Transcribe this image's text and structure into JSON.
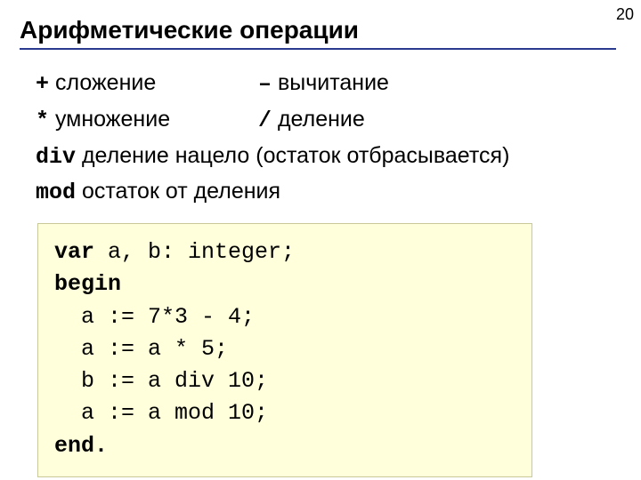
{
  "page_number": "20",
  "heading": "Арифметические операции",
  "ops": {
    "plus_sym": "+",
    "plus_label": " сложение",
    "minus_sym": "–",
    "minus_label": " вычитание",
    "mul_sym": "*",
    "mul_label": " умножение",
    "div_sym": "/",
    "div_label": " деление",
    "idiv_sym": "div",
    "idiv_label": " деление нацело (остаток отбрасывается)",
    "mod_sym": "mod",
    "mod_label": " остаток от деления"
  },
  "code": {
    "kw_var": "var",
    "l1_rest": " a, b: integer;",
    "kw_begin": "begin",
    "l3": "  a := 7*3 - 4;",
    "l4": "  a := a * 5;",
    "l5": "  b := a div 10;",
    "l6": "  a := a mod 10;",
    "kw_end": "end."
  }
}
